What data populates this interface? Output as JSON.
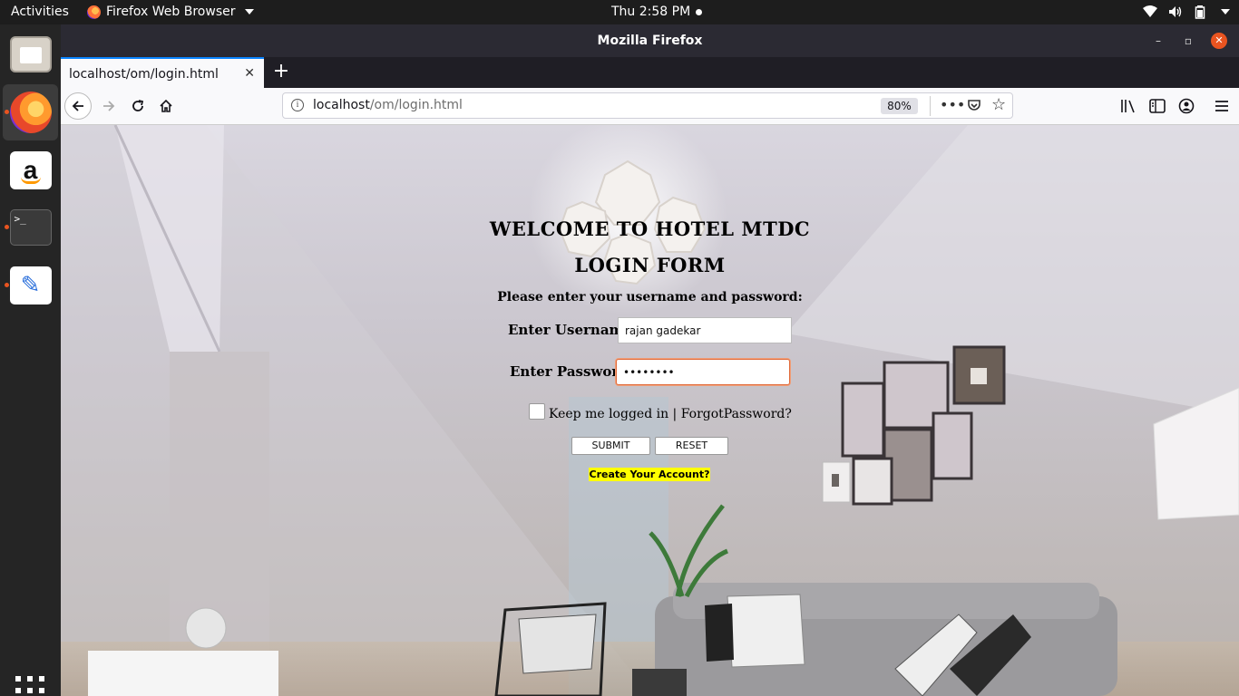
{
  "system_bar": {
    "activities": "Activities",
    "app_name": "Firefox Web Browser",
    "clock": "Thu  2:58 PM"
  },
  "dock": {
    "items": [
      "files-icon",
      "firefox-icon",
      "amazon-icon",
      "terminal-icon",
      "text-editor-icon"
    ],
    "terminal_glyph": ">_",
    "amazon_glyph": "a"
  },
  "window": {
    "title": "Mozilla Firefox"
  },
  "tabs": [
    {
      "label": "localhost/om/login.html"
    }
  ],
  "address_bar": {
    "host": "localhost",
    "path": "/om/login.html",
    "zoom": "80%"
  },
  "login": {
    "welcome": "WELCOME TO HOTEL MTDC",
    "form_title": "LOGIN FORM",
    "instruction": "Please enter your username and password:",
    "username_label": "Enter Username:",
    "username_value": "rajan gadekar",
    "password_label": "Enter Password:",
    "password_value": "••••••••",
    "keep_logged": "Keep me logged in | ForgotPassword?",
    "submit": "SUBMIT",
    "reset": "RESET",
    "create_account": "Create Your Account?"
  },
  "colors": {
    "accent": "#e95420",
    "create_bg": "#ffff00",
    "focus_border": "#e06a3a"
  }
}
